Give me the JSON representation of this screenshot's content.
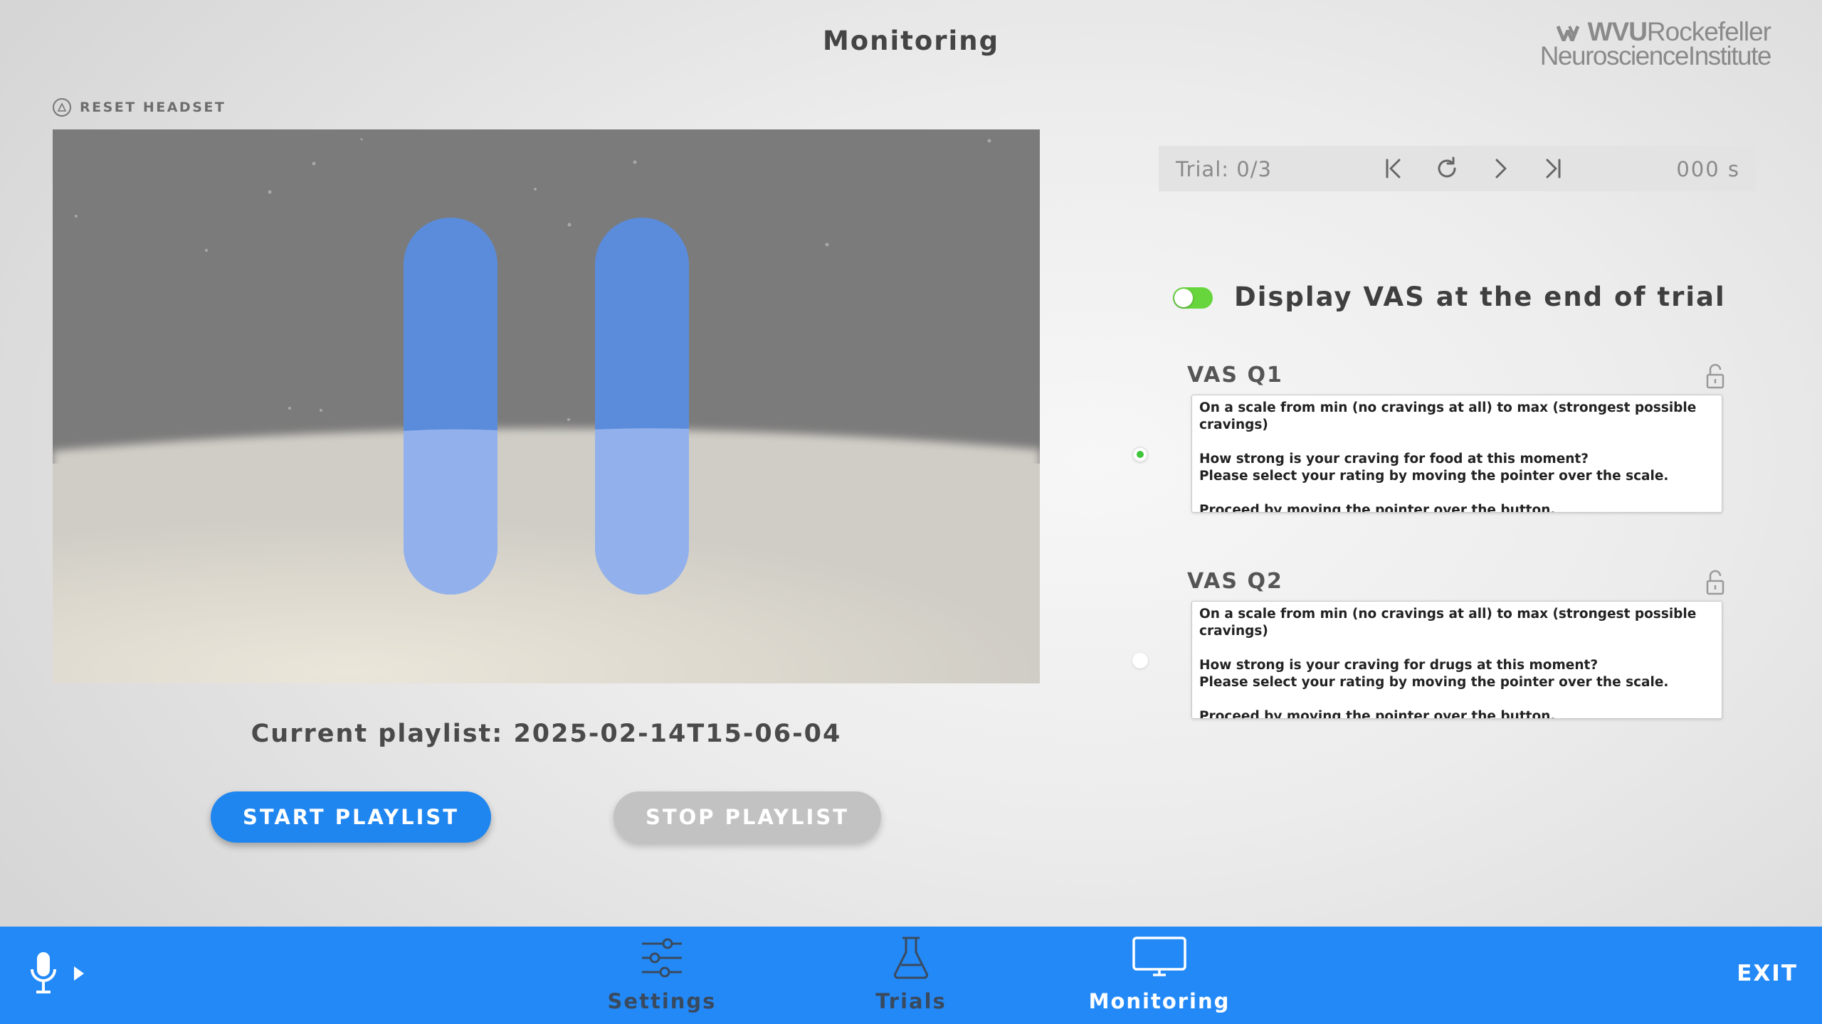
{
  "header": {
    "title": "Monitoring"
  },
  "logo": {
    "line1_bold": "WVU",
    "line1_rest": "Rockefeller",
    "line2": "NeuroscienceInstitute"
  },
  "reset_headset": {
    "label": "RESET HEADSET",
    "icon": "reset-circle-icon"
  },
  "playlist": {
    "current_label": "Current playlist: 2025-02-14T15-06-04",
    "start_label": "START PLAYLIST",
    "stop_label": "STOP PLAYLIST"
  },
  "trial_controls": {
    "trial_label": "Trial: 0/3",
    "time_label": "000 s",
    "icons": [
      "skip-to-start-icon",
      "restart-icon",
      "next-icon",
      "skip-to-end-icon"
    ]
  },
  "vas": {
    "toggle_label": "Display VAS at the end of trial",
    "toggle_on": true,
    "questions": [
      {
        "title": "VAS Q1",
        "text": "On a scale from min (no cravings at all) to max (strongest possible cravings)\n\nHow strong is your craving for food at this moment?\nPlease select your rating by moving the pointer over the scale.\n\nProceed by moving the pointer over the button.",
        "selected": true
      },
      {
        "title": "VAS Q2",
        "text": "On a scale from min (no cravings at all) to max (strongest possible cravings)\n\nHow strong is your craving for drugs at this moment?\nPlease select your rating by moving the pointer over the scale.\n\nProceed by moving the pointer over the button.",
        "selected": false
      }
    ]
  },
  "nav": {
    "items": [
      {
        "label": "Settings",
        "icon": "sliders-icon",
        "active": false
      },
      {
        "label": "Trials",
        "icon": "flask-icon",
        "active": false
      },
      {
        "label": "Monitoring",
        "icon": "monitor-icon",
        "active": true
      }
    ],
    "exit_label": "EXIT"
  },
  "colors": {
    "accent": "#2389f7",
    "start_button": "#1f86f0",
    "stop_button": "#c2c2c2",
    "toggle_on": "#67d63d",
    "nav_inactive": "#3a4a5e",
    "nav_active": "#ffffff"
  }
}
